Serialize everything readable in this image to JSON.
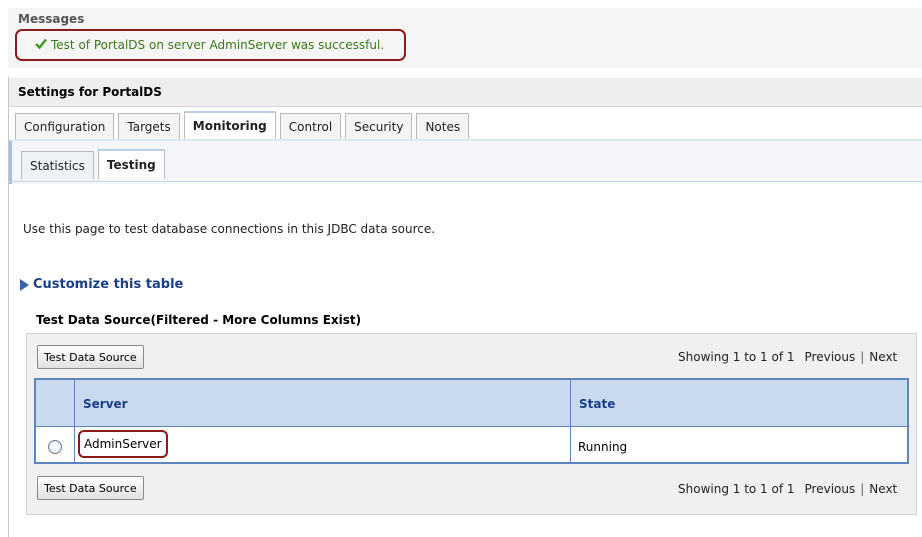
{
  "messages": {
    "title": "Messages",
    "success_text": "Test of PortalDS on server AdminServer was successful.",
    "success_color": "#3a7a1a"
  },
  "settings": {
    "title": "Settings for PortalDS"
  },
  "tabs": [
    "Configuration",
    "Targets",
    "Monitoring",
    "Control",
    "Security",
    "Notes"
  ],
  "active_tab": "Monitoring",
  "subtabs": [
    "Statistics",
    "Testing"
  ],
  "active_subtab": "Testing",
  "description": "Use this page to test database connections in this JDBC data source.",
  "customize_label": "Customize this table",
  "table": {
    "title": "Test Data Source(Filtered - More Columns Exist)",
    "button_label": "Test Data Source",
    "pager": {
      "showing": "Showing 1 to 1 of 1",
      "previous": "Previous",
      "separator": "|",
      "next": "Next"
    },
    "columns": [
      "Server",
      "State"
    ],
    "rows": [
      {
        "server": "AdminServer",
        "state": "Running"
      }
    ]
  },
  "icons": {
    "success": "check-icon",
    "customize": "expand-triangle-icon"
  }
}
